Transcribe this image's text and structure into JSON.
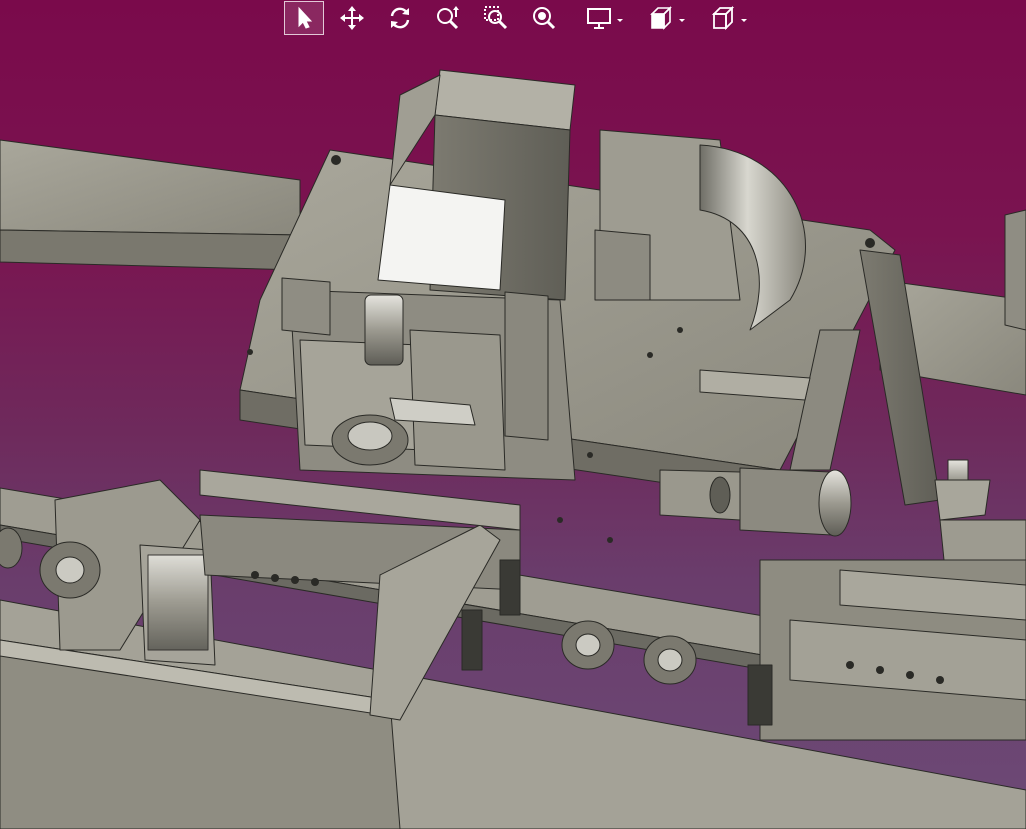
{
  "app": {
    "view": "3d-cad-viewport"
  },
  "colors": {
    "background_top": "#7a0a4b",
    "background_bottom": "#6c4a76",
    "model_gray": "#9c9a8e",
    "model_edge": "#2a2a26",
    "toolbar_icon": "#ffffff",
    "toolbar_active_border": "#ffffff"
  },
  "toolbar": {
    "tools": [
      {
        "id": "select",
        "icon": "cursor-arrow-icon",
        "active": true,
        "has_menu": false
      },
      {
        "id": "pan",
        "icon": "move-arrows-icon",
        "active": false,
        "has_menu": false
      },
      {
        "id": "rotate",
        "icon": "rotate-icon",
        "active": false,
        "has_menu": false
      },
      {
        "id": "zoom-wheel",
        "icon": "zoom-updown-icon",
        "active": false,
        "has_menu": false
      },
      {
        "id": "zoom-window",
        "icon": "zoom-window-icon",
        "active": false,
        "has_menu": false
      },
      {
        "id": "zoom-fit",
        "icon": "zoom-fit-icon",
        "active": false,
        "has_menu": false
      },
      {
        "id": "display",
        "icon": "monitor-icon",
        "active": false,
        "has_menu": true
      },
      {
        "id": "render-mode",
        "icon": "shaded-cube-icon",
        "active": false,
        "has_menu": true
      },
      {
        "id": "view-orientation",
        "icon": "wireframe-cube-icon",
        "active": false,
        "has_menu": true
      }
    ]
  }
}
